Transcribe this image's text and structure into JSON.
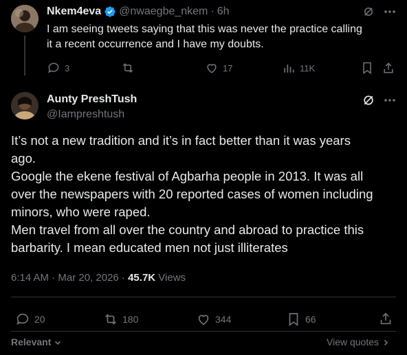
{
  "parent": {
    "name": "Nkem4eva",
    "handle": "@nwaegbe_nkem",
    "separator": "·",
    "time": "6h",
    "text_line1": "I am seeing tweets saying that this was never the practice calling",
    "text_line2": "it a recent occurrence and I have my doubts.",
    "replies": "3",
    "likes": "17",
    "views": "11K",
    "verified_color": "#1d9bf0"
  },
  "main": {
    "name": "Aunty PreshTush",
    "handle": "@Iampreshtush",
    "lines": [
      "It’s not a new tradition and it’s in fact better than it was years",
      "ago.",
      "Google the ekene festival of Agbarha people in 2013. It was all",
      "over the newspapers with 20 reported cases of women including",
      "minors, who were raped.",
      "Men travel from all over the country and abroad to practice this",
      "barbarity. I mean educated men not just illiterates"
    ],
    "timestamp": "6:14 AM · Mar 20, 2026 ·",
    "views_count": "45.7K",
    "views_label": "Views",
    "replies": "20",
    "reposts": "180",
    "likes": "344",
    "bookmarks": "66"
  },
  "footer": {
    "sort_label": "Relevant",
    "view_quotes_label": "View quotes"
  },
  "colors": {
    "background": "#000000",
    "text": "#e7e9ea",
    "muted": "#71767b",
    "verified": "#1d9bf0"
  }
}
